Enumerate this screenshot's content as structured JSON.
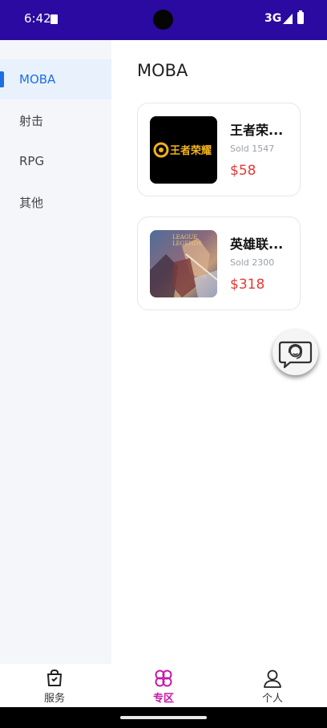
{
  "status_bar": {
    "time": "6:42",
    "network": "3G",
    "background_color": "#2a0aa0"
  },
  "sidebar": {
    "items": [
      {
        "label": "MOBA",
        "selected": true
      },
      {
        "label": "射击",
        "selected": false
      },
      {
        "label": "RPG",
        "selected": false
      },
      {
        "label": "其他",
        "selected": false
      }
    ]
  },
  "main": {
    "title": "MOBA",
    "products": [
      {
        "name": "王者荣...",
        "sold": "Sold 1547",
        "price": "$58",
        "thumb_text": "王者荣耀"
      },
      {
        "name": "英雄联...",
        "sold": "Sold 2300",
        "price": "$318",
        "thumb_text_line1": "LEAGUE",
        "thumb_text_line2": "LEGENDS"
      }
    ]
  },
  "fab": {
    "icon": "customer-service-chat-icon"
  },
  "bottom_nav": {
    "items": [
      {
        "label": "服务",
        "icon": "shopping-bag-icon",
        "active": false
      },
      {
        "label": "专区",
        "icon": "clover-icon",
        "active": true
      },
      {
        "label": "个人",
        "icon": "person-icon",
        "active": false
      }
    ]
  },
  "colors": {
    "accent_blue": "#1d6ee6",
    "price_red": "#e53935",
    "active_nav": "#c518a8",
    "sidebar_bg": "#f4f6f9"
  }
}
